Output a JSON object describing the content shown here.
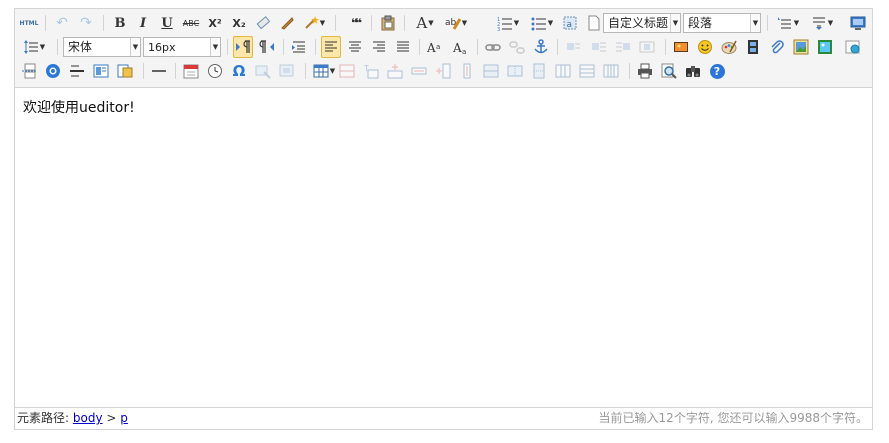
{
  "toolbar": {
    "html_label": "HTML",
    "bold_label": "B",
    "italic_label": "I",
    "underline_label": "U",
    "strike_label": "ABC",
    "sup_label": "X²",
    "sub_label": "X₂",
    "quote_label": "❝❝",
    "fontcolor_label": "A",
    "custom_style_select": "自定义标题",
    "paragraph_select": "段落",
    "font_family_select": "宋体",
    "font_size_select": "16px",
    "omega_label": "Ω",
    "help_label": "?"
  },
  "editor": {
    "content": "欢迎使用ueditor!"
  },
  "statusbar": {
    "path_label": "元素路径:",
    "path_items": [
      "body",
      "p"
    ],
    "path_separator": ">",
    "word_count": "当前已输入12个字符, 您还可以输入9988个字符。"
  },
  "colors": {
    "toolbar_bg": "#f4f4f4",
    "border": "#d4d4d4",
    "active_bg": "#fbe7a7",
    "link": "#0000cc",
    "icon_blue": "#3a7ac8",
    "help_blue": "#2b76d8"
  }
}
